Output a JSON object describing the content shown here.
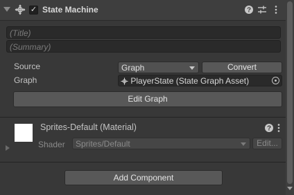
{
  "component": {
    "title": "State Machine",
    "enabled_check": "✓",
    "icons": [
      "move-arrows-icon",
      "help-icon",
      "preset-sliders-icon",
      "kebab-menu-icon"
    ]
  },
  "fields": {
    "title_placeholder": "(Title)",
    "summary_placeholder": "(Summary)"
  },
  "source": {
    "label": "Source",
    "value": "Graph",
    "convert_label": "Convert"
  },
  "graph": {
    "label": "Graph",
    "value": "PlayerState (State Graph Asset)",
    "icon": "graph-asset-icon"
  },
  "edit_graph_label": "Edit Graph",
  "material": {
    "title": "Sprites-Default (Material)",
    "shader_label": "Shader",
    "shader_value": "Sprites/Default",
    "edit_label": "Edit...",
    "swatch_color": "#ffffff"
  },
  "add_component_label": "Add Component",
  "colors": {
    "background": "#383838",
    "button": "#585858",
    "field": "#2a2a2a"
  }
}
